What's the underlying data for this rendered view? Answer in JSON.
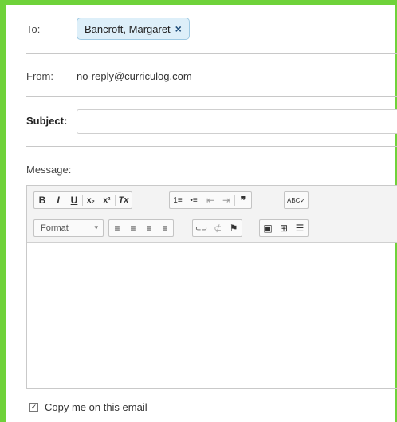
{
  "to": {
    "label": "To:",
    "recipient": "Bancroft, Margaret",
    "remove_icon": "×"
  },
  "from": {
    "label": "From:",
    "value": "no-reply@curriculog.com"
  },
  "subject": {
    "label": "Subject:",
    "value": ""
  },
  "message": {
    "label": "Message:"
  },
  "toolbar": {
    "bold": "B",
    "italic": "I",
    "underline": "U",
    "subscript": "x₂",
    "superscript": "x²",
    "remove_format": "Tx",
    "numbered_list": "1≡",
    "bulleted_list": "•≡",
    "outdent": "⇤",
    "indent": "⇥",
    "blockquote": "❞",
    "spellcheck": "ABC✓",
    "format_label": "Format",
    "format_caret": "▾",
    "align_left": "≡",
    "align_center": "≡",
    "align_right": "≡",
    "justify": "≡",
    "link": "⊂⊃",
    "unlink": "⊄",
    "anchor": "⚑",
    "image": "▣",
    "table": "⊞",
    "horizontal_rule": "☰"
  },
  "copy_me": {
    "label": "Copy me on this email",
    "checked": true
  },
  "colors": {
    "frame": "#6fd23a",
    "chip_bg": "#ddeff9",
    "chip_border": "#9ec9e2"
  }
}
